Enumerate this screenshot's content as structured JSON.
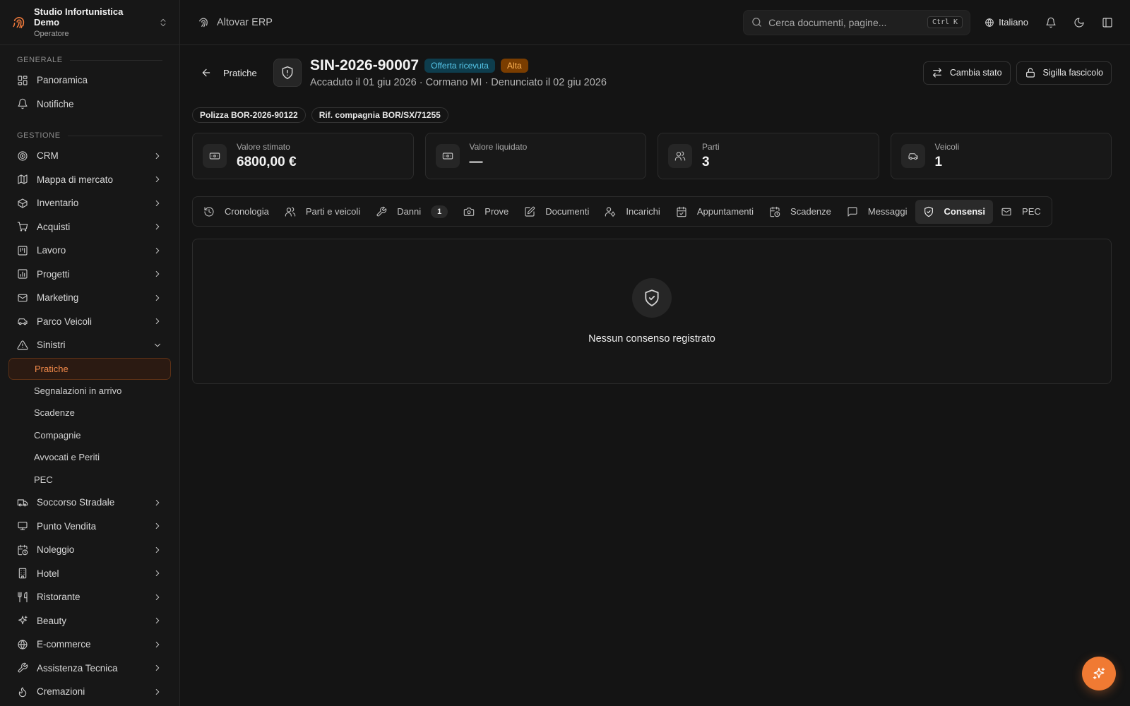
{
  "workspace": {
    "name": "Studio Infortunistica Demo",
    "role": "Operatore"
  },
  "sidebar": {
    "section_general": "GENERALE",
    "section_management": "GESTIONE",
    "general_items": [
      {
        "label": "Panoramica",
        "icon": "dashboard-icon"
      },
      {
        "label": "Notifiche",
        "icon": "bell-icon"
      }
    ],
    "management_items": [
      {
        "label": "CRM",
        "icon": "target-icon"
      },
      {
        "label": "Mappa di mercato",
        "icon": "map-icon"
      },
      {
        "label": "Inventario",
        "icon": "box-icon"
      },
      {
        "label": "Acquisti",
        "icon": "cart-icon"
      },
      {
        "label": "Lavoro",
        "icon": "kanban-icon"
      },
      {
        "label": "Progetti",
        "icon": "chart-icon"
      },
      {
        "label": "Marketing",
        "icon": "mail-icon"
      },
      {
        "label": "Parco Veicoli",
        "icon": "car-icon"
      },
      {
        "label": "Sinistri",
        "icon": "warning-icon",
        "expanded": true
      }
    ],
    "sinistri_sub": [
      "Pratiche",
      "Segnalazioni in arrivo",
      "Scadenze",
      "Compagnie",
      "Avvocati e Periti",
      "PEC"
    ],
    "active_sub": "Pratiche",
    "more_items": [
      {
        "label": "Soccorso Stradale",
        "icon": "truck-icon"
      },
      {
        "label": "Punto Vendita",
        "icon": "monitor-icon"
      },
      {
        "label": "Noleggio",
        "icon": "calendar-clock-icon"
      },
      {
        "label": "Hotel",
        "icon": "building-icon"
      },
      {
        "label": "Ristorante",
        "icon": "utensils-icon"
      },
      {
        "label": "Beauty",
        "icon": "sparkles-icon"
      },
      {
        "label": "E-commerce",
        "icon": "globe-icon"
      },
      {
        "label": "Assistenza Tecnica",
        "icon": "wrench-icon"
      },
      {
        "label": "Cremazioni",
        "icon": "flame-icon"
      }
    ]
  },
  "topbar": {
    "app_title": "Altovar ERP",
    "search_placeholder": "Cerca documenti, pagine...",
    "shortcut": "Ctrl K",
    "language": "Italiano"
  },
  "header": {
    "back_label": "Pratiche",
    "case_id": "SIN-2026-90007",
    "status_badge": "Offerta ricevuta",
    "priority_badge": "Alta",
    "subtitle": "Accaduto il 01 giu 2026 · Cormano MI · Denunciato il 02 giu 2026",
    "change_status_label": "Cambia stato",
    "seal_label": "Sigilla fascicolo"
  },
  "chips": [
    "Polizza BOR-2026-90122",
    "Rif. compagnia BOR/SX/71255"
  ],
  "stats": [
    {
      "label": "Valore stimato",
      "value": "6800,00 €",
      "icon": "banknote-icon"
    },
    {
      "label": "Valore liquidato",
      "value": "—",
      "icon": "banknote-icon"
    },
    {
      "label": "Parti",
      "value": "3",
      "icon": "users-icon"
    },
    {
      "label": "Veicoli",
      "value": "1",
      "icon": "car-icon"
    }
  ],
  "tabs": [
    {
      "label": "Cronologia",
      "icon": "history-icon"
    },
    {
      "label": "Parti e veicoli",
      "icon": "users-icon"
    },
    {
      "label": "Danni",
      "icon": "wrench-icon",
      "count": "1"
    },
    {
      "label": "Prove",
      "icon": "camera-icon"
    },
    {
      "label": "Documenti",
      "icon": "edit-icon"
    },
    {
      "label": "Incarichi",
      "icon": "user-cog-icon"
    },
    {
      "label": "Appuntamenti",
      "icon": "calendar-check-icon"
    },
    {
      "label": "Scadenze",
      "icon": "calendar-clock-icon"
    },
    {
      "label": "Messaggi",
      "icon": "message-icon"
    },
    {
      "label": "Consensi",
      "icon": "shield-check-icon",
      "active": true
    },
    {
      "label": "PEC",
      "icon": "mail-icon"
    }
  ],
  "empty_state": {
    "message": "Nessun consenso registrato"
  }
}
